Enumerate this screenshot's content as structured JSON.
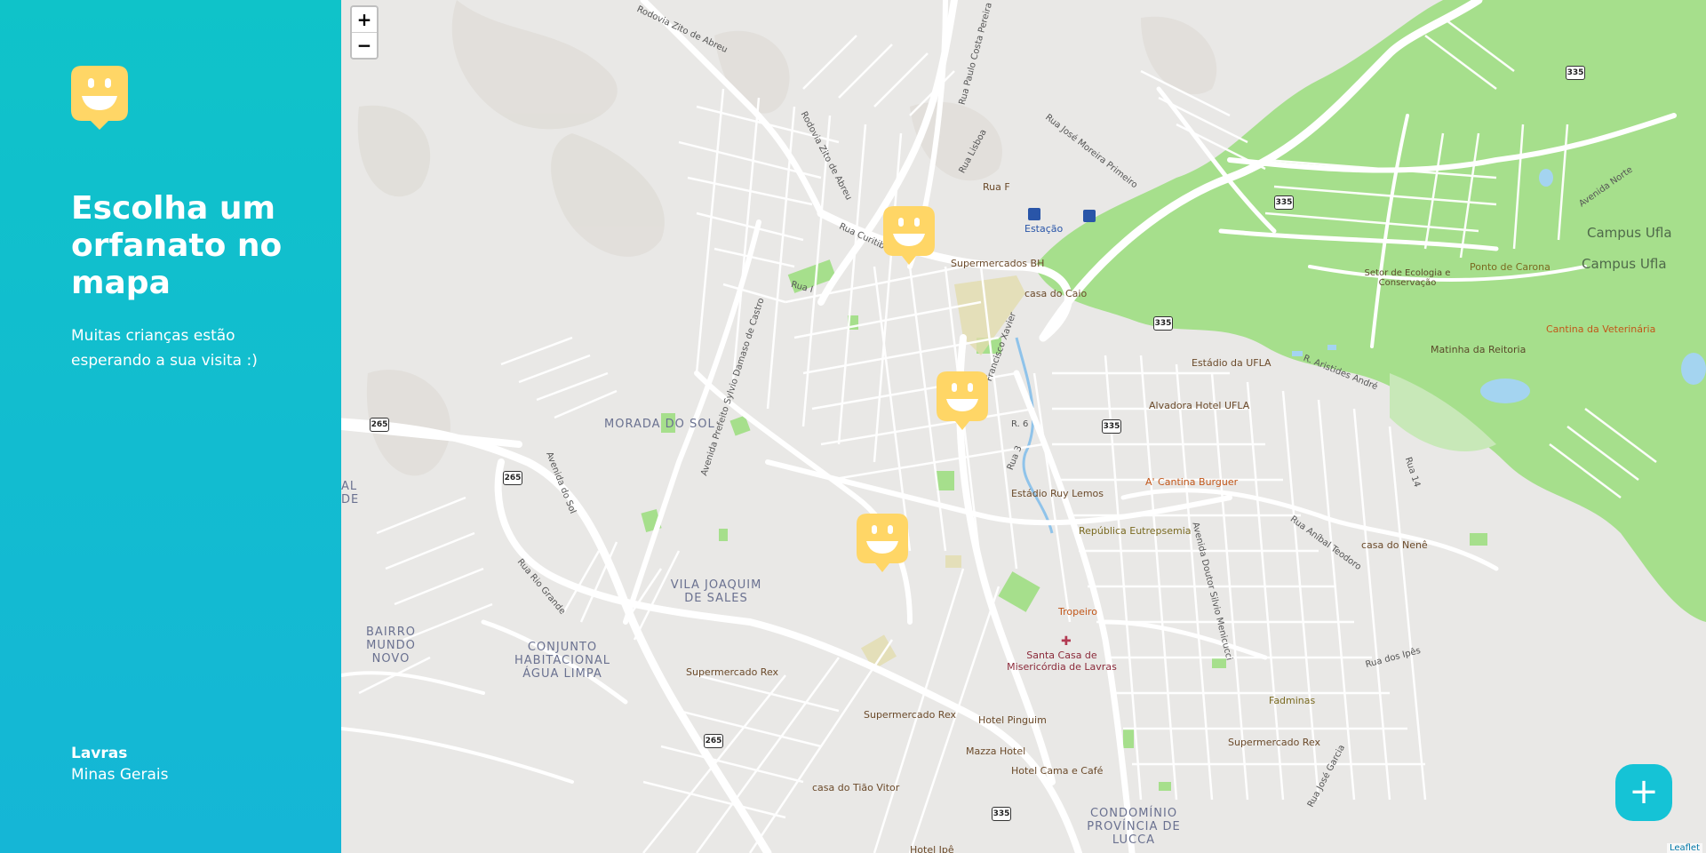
{
  "sidebar": {
    "title": "Escolha um orfanato no mapa",
    "subtitle": "Muitas crianças estão esperando a sua visita :)",
    "location": {
      "city": "Lavras",
      "state": "Minas Gerais"
    }
  },
  "map": {
    "zoom_in_label": "+",
    "zoom_out_label": "−",
    "add_button_label": "+",
    "attribution": "Leaflet",
    "colors": {
      "sidebar_start": "#0fc3c9",
      "sidebar_end": "#15b6d6",
      "marker": "#ffd666",
      "add_button": "#15c3d6",
      "park": "#a6df8c",
      "road": "#ffffff",
      "background": "#e9e8e6"
    },
    "labels": {
      "rodovia_zito_top": "Rodovia Zito de Abreu",
      "rodovia_zito_mid": "Rodovia Zito de Abreu",
      "rua_paulo": "Rua Paulo Costa Pereira",
      "rua_lisboa": "Rua Lisboa",
      "rua_jose_moreira": "Rua José Moreira Primeiro",
      "rua_f": "Rua F",
      "estacao": "Estação",
      "rua_curitiba": "Rua Curitiba",
      "supermercados_bh": "Supermercados BH",
      "casa_do_caio": "casa do Caio",
      "rua_i": "Rua I",
      "francisco_xavier": "Francisco Xavier",
      "av_prefeito": "Avenida Prefeito Sylvio Damaso de Castro",
      "morada_do_sol": "MORADA DO SOL",
      "r6": "R. 6",
      "rua3": "Rua 3",
      "avenida_do_sol": "Avenida do Sol",
      "estadio_ufla": "Estádio da UFLA",
      "alvadora": "Alvadora Hotel UFLA",
      "r_aristides": "R. Aristides André",
      "cantina_burguer": "A' Cantina Burguer",
      "estadio_ruy": "Estádio Ruy Lemos",
      "republica": "República Eutrepsemia",
      "av_dr_silvio": "Avenida Doutor Silvio Menicucci",
      "rua_14": "Rua 14",
      "rua_anibal": "Rua Aníbal Teodoro",
      "casa_nene": "casa do Nenê",
      "campus1": "Campus Ufla",
      "campus2": "Campus Ufla",
      "setor_ecologia": "Setor de Ecologia e Conservação",
      "ponto_carona": "Ponto de Carona",
      "cantina_vet": "Cantina da Veterinária",
      "matinha": "Matinha da Reitoria",
      "avenida_norte": "Avenida Norte",
      "vila_joaquim": "VILA JOAQUIM DE SALES",
      "tropeiro": "Tropeiro",
      "santa_casa": "Santa Casa de Misericórdia de Lavras",
      "rua_rio_grande": "Rua Rio Grande",
      "bairro_mundo_novo": "BAIRRO MUNDO NOVO",
      "conjunto": "CONJUNTO HABITACIONAL ÁGUA LIMPA",
      "supermercado_rex1": "Supermercado Rex",
      "supermercado_rex2": "Supermercado Rex",
      "supermercado_rex3": "Supermercado Rex",
      "hotel_pinguim": "Hotel Pinguim",
      "mazza_hotel": "Mazza Hotel",
      "hotel_cama": "Hotel Cama e Café",
      "casa_tiao": "casa do Tião Vitor",
      "hotel_ipe": "Hotel Ipê",
      "condominio": "CONDOMÍNIO PROVÍNCIA DE LUCCA",
      "rua_dos_ipes": "Rua dos Ipês",
      "fadminas": "Fadminas",
      "rua_jose_garcia": "Rua José Garcia",
      "al_de": "AL DE"
    },
    "shields": [
      "335",
      "335",
      "335",
      "335",
      "335",
      "265",
      "265",
      "265"
    ]
  }
}
